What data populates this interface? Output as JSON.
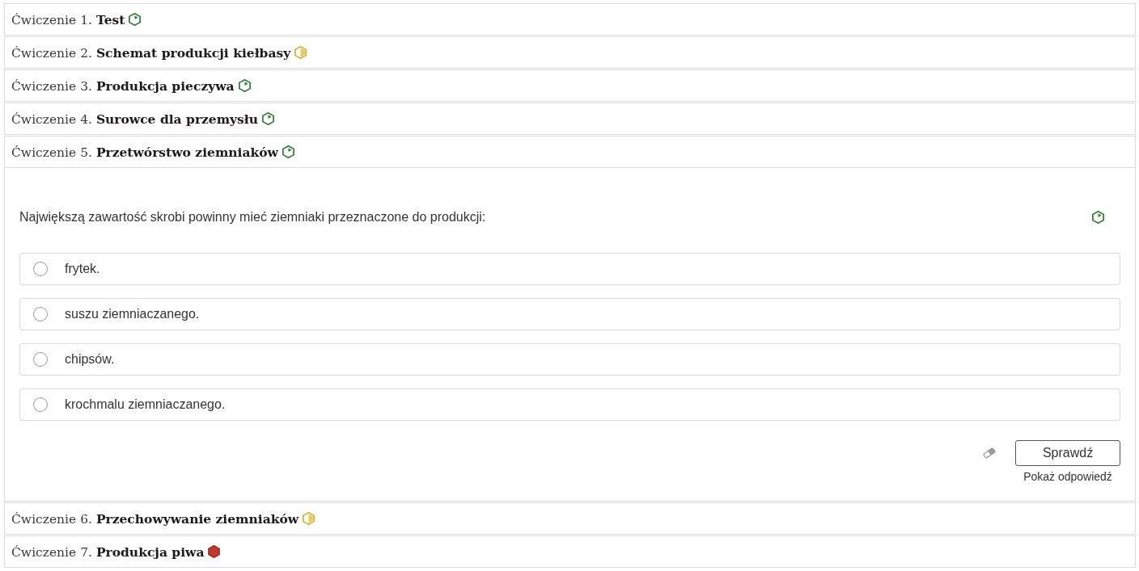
{
  "exercises": [
    {
      "heading": "Ćwiczenie 1. **Test**",
      "kind": "easy"
    },
    {
      "heading": "Ćwiczenie 2. **Schemat produkcji kiełbasy**",
      "kind": "medium"
    },
    {
      "heading": "Ćwiczenie 3. **Produkcja pieczywa**",
      "kind": "easy"
    },
    {
      "heading": "Ćwiczenie 4. **Surowce dla przemysłu**",
      "kind": "easy"
    },
    {
      "heading": "Ćwiczenie 5. **Przetwórstwo ziemniaków**",
      "kind": "easy",
      "content": {
        "question": "Największą zawartość skrobi powinny mieć ziemniaki przeznaczone do produkcji:",
        "kind": "easy",
        "options": [
          {
            "label": "frytek.",
            "selected": false
          },
          {
            "label": "suszu ziemniaczanego.",
            "selected": false
          },
          {
            "label": "chipsów.",
            "selected": false
          },
          {
            "label": "krochmalu ziemniaczanego.",
            "selected": false
          }
        ],
        "check_button": "Sprawdź",
        "show_answer_link": "Pokaż odpowiedź"
      }
    },
    {
      "heading": "Ćwiczenie 6. **Przechowywanie ziemniaków**",
      "kind": "medium"
    },
    {
      "heading": "Ćwiczenie 7. **Produkcja piwa**",
      "kind": "hard"
    }
  ]
}
